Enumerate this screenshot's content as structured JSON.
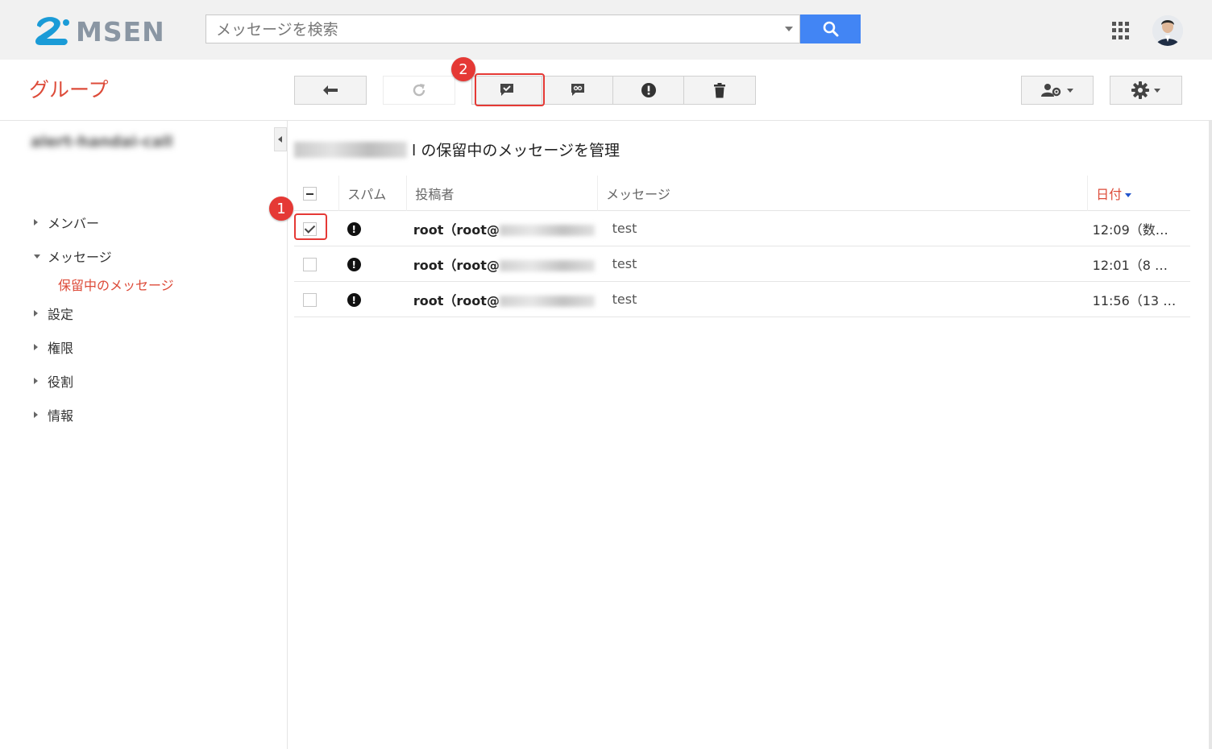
{
  "header": {
    "logo_text": "MSEN",
    "search_placeholder": "メッセージを検索"
  },
  "subheader": {
    "group_title": "グループ"
  },
  "sidebar": {
    "group_name": "alert-handai-call",
    "items": [
      {
        "label": "メンバー",
        "expanded": false
      },
      {
        "label": "メッセージ",
        "expanded": true
      },
      {
        "label": "設定",
        "expanded": false
      },
      {
        "label": "権限",
        "expanded": false
      },
      {
        "label": "役割",
        "expanded": false
      },
      {
        "label": "情報",
        "expanded": false
      }
    ],
    "active_subitem": "保留中のメッセージ"
  },
  "main": {
    "title_suffix": "l の保留中のメッセージを管理",
    "columns": {
      "spam": "スパム",
      "author": "投稿者",
      "message": "メッセージ",
      "date": "日付"
    },
    "rows": [
      {
        "author": "root（root@",
        "message": "test",
        "date": "12:09（数…",
        "checked": true
      },
      {
        "author": "root（root@",
        "message": "test",
        "date": "12:01（8 …",
        "checked": false
      },
      {
        "author": "root（root@",
        "message": "test",
        "date": "11:56（13 …",
        "checked": false
      }
    ]
  },
  "annotations": {
    "badge1": "1",
    "badge2": "2"
  },
  "colors": {
    "accent_red": "#dd4b39",
    "search_blue": "#4285f4",
    "annotation_red": "#e53935"
  }
}
